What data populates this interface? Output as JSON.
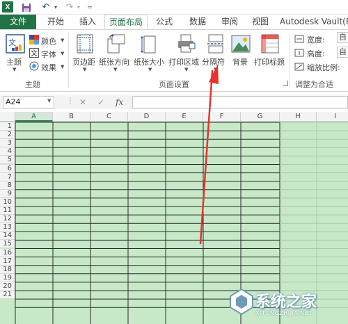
{
  "quick_access": {
    "app_logo": "X",
    "save_icon": "💾",
    "undo_icon": "↶",
    "redo_icon": "↷",
    "dropdown": "▾",
    "more": "="
  },
  "tabs": {
    "file": "文件",
    "home": "开始",
    "insert": "插入",
    "page_layout": "页面布局",
    "formulas": "公式",
    "data": "数据",
    "review": "审阅",
    "view": "视图",
    "autodesk": "Autodesk Vault(R"
  },
  "ribbon": {
    "themes": {
      "theme_label": "主题",
      "colors_label": "颜色",
      "fonts_label": "字体",
      "effects_label": "效果",
      "group_label": "主题"
    },
    "page_setup": {
      "margins_label": "页边距",
      "orientation_label": "纸张方向",
      "size_label": "纸张大小",
      "print_area_label": "打印区域",
      "breaks_label": "分隔符",
      "background_label": "背景",
      "print_titles_label": "打印标题",
      "group_label": "页面设置"
    },
    "scale": {
      "width_label": "宽度:",
      "width_value": "自",
      "height_label": "高度:",
      "height_value": "自",
      "scale_label": "缩放比例:",
      "group_label": "调整为合适"
    }
  },
  "formula_bar": {
    "name_box": "A24",
    "cancel": "✕",
    "enter": "✓",
    "fx": "fx",
    "value": ""
  },
  "sheet": {
    "columns": [
      "A",
      "B",
      "C",
      "D",
      "E",
      "F",
      "G",
      "H",
      "I"
    ],
    "selected_column": "A",
    "rows": [
      "1",
      "2",
      "3",
      "4",
      "5",
      "6",
      "7",
      "8",
      "9",
      "10",
      "11",
      "12",
      "13",
      "14",
      "15",
      "16",
      "17",
      "18",
      "19",
      "20",
      "21"
    ]
  },
  "watermark": {
    "text": "系统之家",
    "url": "XITONGZHIJIA.NET"
  },
  "colors": {
    "excel_green": "#217346",
    "grid_fill": "#c7e9c8",
    "arrow_red": "#e8322d"
  }
}
